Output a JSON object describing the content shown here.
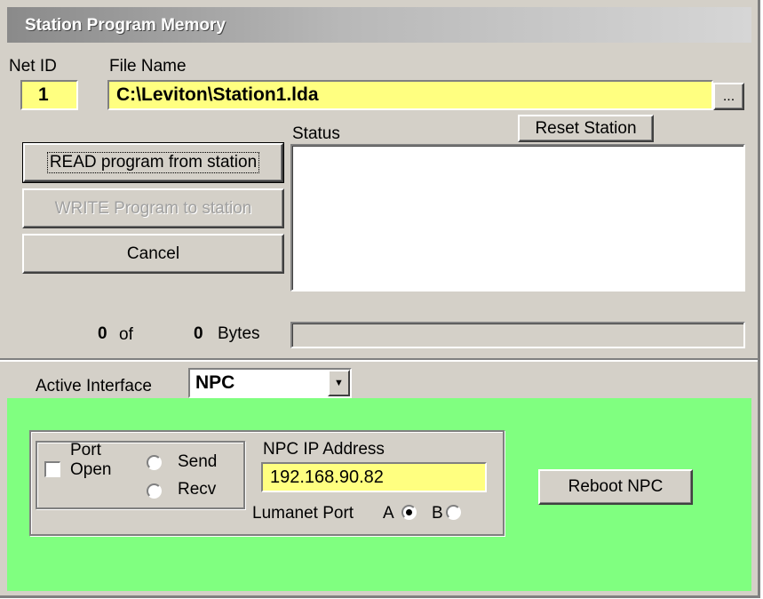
{
  "window": {
    "title": "Station Program Memory"
  },
  "top": {
    "net_id_label": "Net ID",
    "net_id_value": "1",
    "file_name_label": "File Name",
    "file_name_value": "C:\\Leviton\\Station1.lda",
    "browse_label": "..."
  },
  "buttons": {
    "read": "READ program from station",
    "write": "WRITE Program to station",
    "cancel": "Cancel",
    "reset": "Reset Station"
  },
  "status": {
    "label": "Status",
    "text": ""
  },
  "progress": {
    "done": "0",
    "of_label": "of",
    "total": "0",
    "bytes_label": "Bytes",
    "fraction": 0
  },
  "interface": {
    "label": "Active Interface",
    "selected": "NPC"
  },
  "npc": {
    "port_label_1": "Port",
    "port_label_2": "Open",
    "port_open": false,
    "send_label": "Send",
    "recv_label": "Recv",
    "ip_label": "NPC  IP Address",
    "ip_value": "192.168.90.82",
    "lumanet_label": "Lumanet Port",
    "port_a_label": "A",
    "port_b_label": "B",
    "selected_port": "A",
    "reboot_label": "Reboot NPC"
  },
  "colors": {
    "field_yellow": "#ffff80",
    "panel_green": "#80ff80",
    "face": "#d4d0c8"
  }
}
